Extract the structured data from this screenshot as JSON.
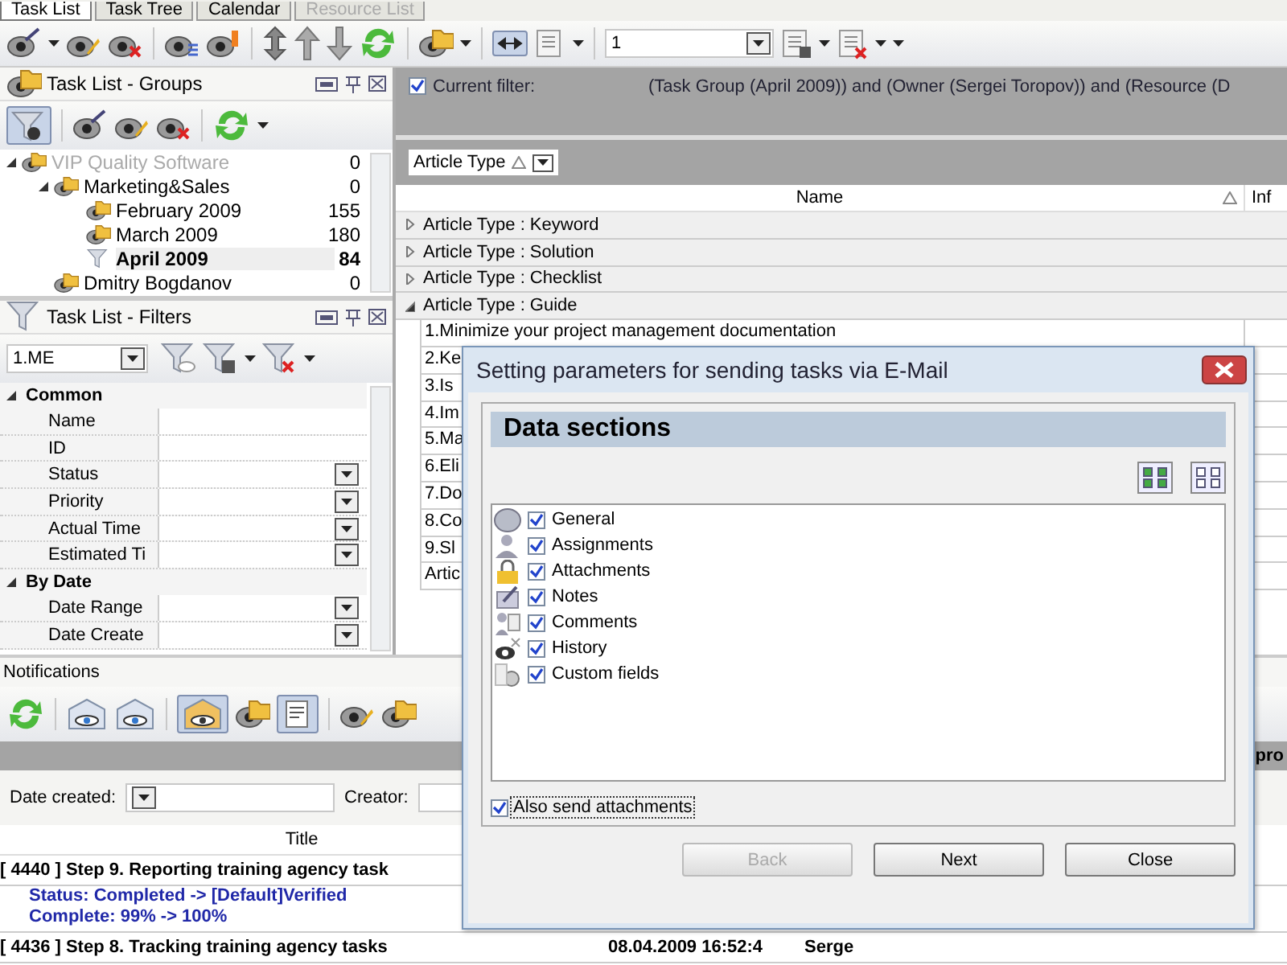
{
  "tabs": [
    {
      "label": "Task List",
      "selected": true,
      "disabled": false
    },
    {
      "label": "Task Tree",
      "selected": false,
      "disabled": false
    },
    {
      "label": "Calendar",
      "selected": false,
      "disabled": false
    },
    {
      "label": "Resource List",
      "selected": false,
      "disabled": true
    }
  ],
  "toolbar": {
    "view_field": {
      "value": "1"
    }
  },
  "groups_panel": {
    "title": "Task List - Groups",
    "tree": [
      {
        "label": "VIP Quality Software",
        "count": "0",
        "disabled": true,
        "selected": false,
        "expanded": true,
        "children": [
          {
            "label": "Marketing&Sales",
            "count": "0",
            "selected": false,
            "expanded": true,
            "children": [
              {
                "label": "February 2009",
                "count": "155",
                "selected": false,
                "kind": "folder"
              },
              {
                "label": "March 2009",
                "count": "180",
                "selected": false,
                "kind": "folder"
              },
              {
                "label": "April 2009",
                "count": "84",
                "selected": true,
                "kind": "filter"
              }
            ]
          },
          {
            "label": "Dmitry Bogdanov",
            "count": "0",
            "selected": false
          }
        ]
      }
    ]
  },
  "filters_panel": {
    "title": "Task List - Filters",
    "filter_field": {
      "value": "1.ME"
    },
    "categories": [
      {
        "label": "Common",
        "expanded": true,
        "properties": [
          {
            "name": "Name",
            "kind": "text"
          },
          {
            "name": "ID",
            "kind": "text"
          },
          {
            "name": "Status",
            "kind": "dropdown"
          },
          {
            "name": "Priority",
            "kind": "dropdown"
          },
          {
            "name": "Actual Time",
            "kind": "dropdown"
          },
          {
            "name": "Estimated Ti",
            "kind": "dropdown"
          }
        ]
      },
      {
        "label": "By Date",
        "expanded": true,
        "properties": [
          {
            "name": "Date Range",
            "kind": "dropdown"
          },
          {
            "name": "Date Create",
            "kind": "dropdown"
          }
        ]
      }
    ]
  },
  "filter_bar": {
    "checked": true,
    "label": "Current filter:",
    "expression": "(Task Group (April 2009)) and (Owner (Sergei Toropov)) and (Resource (D"
  },
  "grouping": {
    "chip": "Article Type"
  },
  "grid": {
    "columns": [
      "Name",
      "Inf"
    ],
    "groups": [
      {
        "label": "Article Type : Keyword",
        "expanded": false
      },
      {
        "label": "Article Type : Solution",
        "expanded": false
      },
      {
        "label": "Article Type : Checklist",
        "expanded": false
      },
      {
        "label": "Article Type : Guide",
        "expanded": true,
        "rows": [
          "1.Minimize your project management documentation",
          "2.Ke",
          "3.Is",
          "4.Im",
          "5.Ma",
          "6.Eli",
          "7.Do",
          "8.Co",
          "9.Sl",
          "Artic"
        ]
      }
    ]
  },
  "notifications": {
    "title": "Notifications",
    "group_column": "pro",
    "filters": [
      {
        "label": "Date created:",
        "kind": "dropdown"
      },
      {
        "label": "Creator:",
        "kind": "text"
      }
    ],
    "columns": [
      "Title"
    ],
    "entries": [
      {
        "title": "[ 4440 ] Step 9. Reporting training agency task",
        "changes": [
          "Status: Completed -> [Default]Verified",
          "Complete: 99% -> 100%"
        ]
      },
      {
        "title": "[ 4436 ] Step 8. Tracking training agency tasks",
        "date": "08.04.2009 16:52:4",
        "owner": "Serge"
      }
    ]
  },
  "dialog": {
    "title": "Setting parameters for sending tasks via E-Mail",
    "heading": "Data sections",
    "sections": [
      {
        "label": "General",
        "checked": true
      },
      {
        "label": "Assignments",
        "checked": true
      },
      {
        "label": "Attachments",
        "checked": true
      },
      {
        "label": "Notes",
        "checked": true
      },
      {
        "label": "Comments",
        "checked": true
      },
      {
        "label": "History",
        "checked": true
      },
      {
        "label": "Custom fields",
        "checked": true
      }
    ],
    "also_send": {
      "label": "Also send attachments",
      "checked": true
    },
    "buttons": [
      {
        "label": "Back",
        "disabled": true
      },
      {
        "label": "Next",
        "disabled": false
      },
      {
        "label": "Close",
        "disabled": false
      }
    ]
  }
}
